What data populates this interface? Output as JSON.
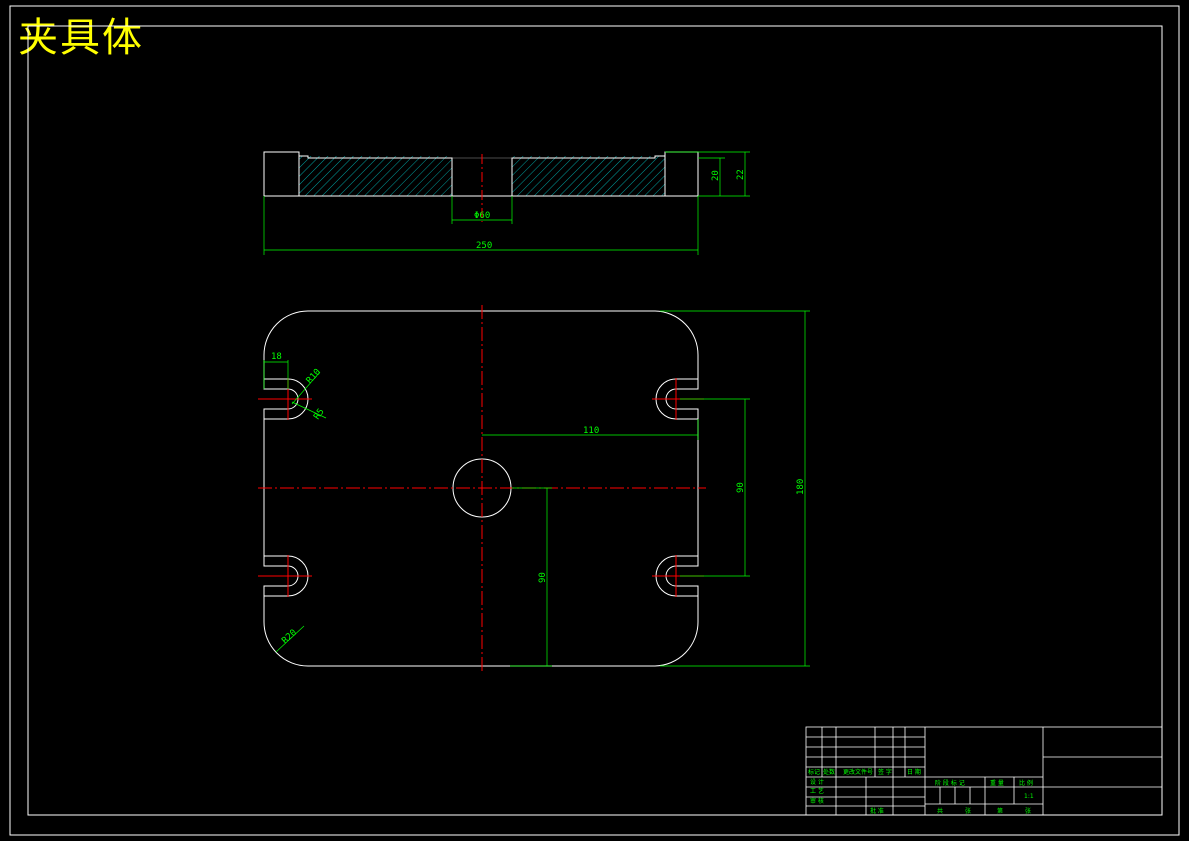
{
  "title": "夹具体",
  "colors": {
    "background": "#000000",
    "outline": "#ffffff",
    "dimension": "#00ff00",
    "centerline": "#ff0000",
    "hatch": "#00c8c8",
    "title": "#ffff00"
  },
  "side_view": {
    "dims": {
      "bore_dia": "Φ60",
      "length": "250",
      "h_inner": "20",
      "h_outer": "22"
    }
  },
  "plan_view": {
    "dims": {
      "slot_width": "18",
      "slot_radius_top": "R10",
      "slot_radius_small": "R5",
      "center_offset": "110",
      "slot_pitch": "90",
      "height": "180",
      "center_height": "90",
      "corner_radius": "R20"
    }
  },
  "title_block": {
    "row_labels": {
      "mark": "标记",
      "count": "处数",
      "change_doc": "更改文件号",
      "sign": "签 字",
      "date": "日 期",
      "design": "设 计",
      "check": "审 核",
      "approve": "批 准"
    },
    "stage_labels": {
      "stage_mark": "阶 段 标 记",
      "weight": "重 量",
      "scale": "比 例",
      "scale_value": "1:1",
      "total": "共",
      "sheets": "张",
      "sheet_no": "第",
      "sheets2": "张",
      "craft": "工 艺"
    }
  }
}
